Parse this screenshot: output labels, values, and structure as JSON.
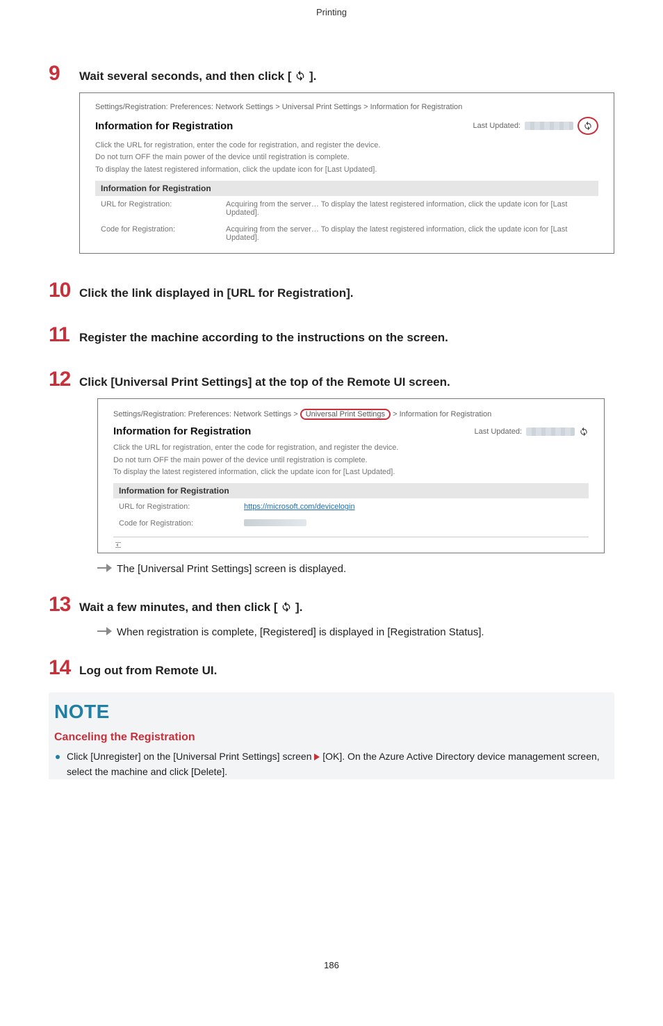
{
  "header": "Printing",
  "steps": {
    "s9": {
      "num": "9",
      "title_pre": "Wait several seconds, and then click [ ",
      "title_post": " ]."
    },
    "s10": {
      "num": "10",
      "title": "Click the link displayed in [URL for Registration]."
    },
    "s11": {
      "num": "11",
      "title": "Register the machine according to the instructions on the screen."
    },
    "s12": {
      "num": "12",
      "title": "Click [Universal Print Settings] at the top of the Remote UI screen."
    },
    "s13": {
      "num": "13",
      "title_pre": "Wait a few minutes, and then click [ ",
      "title_post": " ]."
    },
    "s14": {
      "num": "14",
      "title": "Log out from Remote UI."
    }
  },
  "results": {
    "r12": "The [Universal Print Settings] screen is displayed.",
    "r13": "When registration is complete, [Registered] is displayed in [Registration Status]."
  },
  "screenshot1": {
    "breadcrumb": "Settings/Registration: Preferences: Network Settings > Universal Print Settings > Information for Registration",
    "title": "Information for Registration",
    "last_updated_label": "Last Updated:",
    "p1": "Click the URL for registration, enter the code for registration, and register the device.",
    "p2": "Do not turn OFF the main power of the device until registration is complete.",
    "p3": "To display the latest registered information, click the update icon for [Last Updated].",
    "subhead": "Information for Registration",
    "row1_label": "URL for Registration:",
    "row1_value": "Acquiring from the server… To display the latest registered information, click the update icon for [Last Updated].",
    "row2_label": "Code for Registration:",
    "row2_value": "Acquiring from the server… To display the latest registered information, click the update icon for [Last Updated]."
  },
  "screenshot2": {
    "bc_prefix": "Settings/Registration: Preferences: Network Settings > ",
    "bc_highlight": "Universal Print Settings",
    "bc_suffix": " > Information for Registration",
    "title": "Information for Registration",
    "last_updated_label": "Last Updated:",
    "p1": "Click the URL for registration, enter the code for registration, and register the device.",
    "p2": "Do not turn OFF the main power of the device until registration is complete.",
    "p3": "To display the latest registered information, click the update icon for [Last Updated].",
    "subhead": "Information for Registration",
    "row1_label": "URL for Registration:",
    "row1_link": "https://microsoft.com/devicelogin",
    "row2_label": "Code for Registration:"
  },
  "note": {
    "heading": "NOTE",
    "subtitle": "Canceling the Registration",
    "bullet": "Click [Unregister] on the [Universal Print Settings] screen  [OK]. On the Azure Active Directory device management screen, select the machine and click [Delete]."
  },
  "page_number": "186"
}
